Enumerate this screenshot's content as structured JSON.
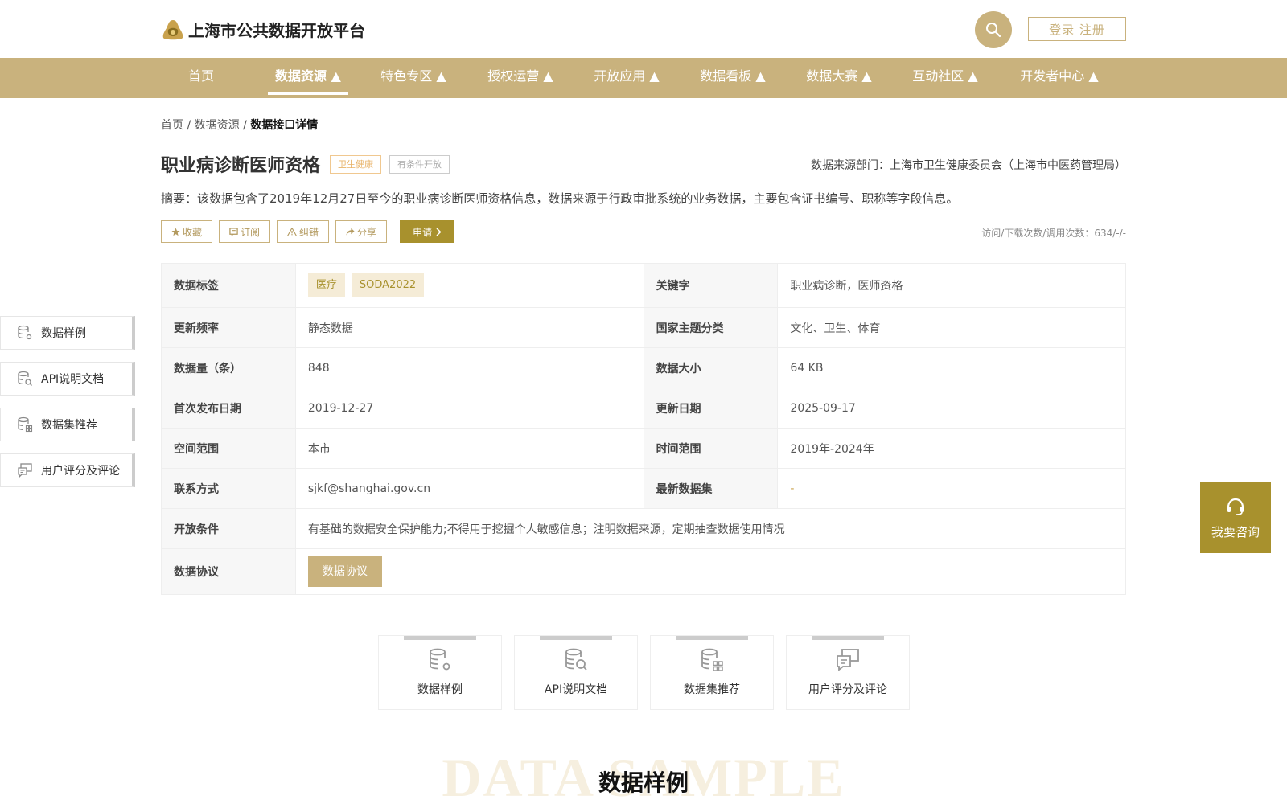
{
  "header": {
    "site_title": "上海市公共数据开放平台",
    "login_label": "登录 注册"
  },
  "nav": {
    "items": [
      {
        "label": "首页"
      },
      {
        "label": "数据资源 ▲"
      },
      {
        "label": "特色专区 ▲"
      },
      {
        "label": "授权运营 ▲"
      },
      {
        "label": "开放应用 ▲"
      },
      {
        "label": "数据看板 ▲"
      },
      {
        "label": "数据大赛 ▲"
      },
      {
        "label": "互动社区 ▲"
      },
      {
        "label": "开发者中心 ▲"
      }
    ],
    "active_index": 1
  },
  "breadcrumb": {
    "home": "首页",
    "sep": " / ",
    "parent": "数据资源",
    "current": "数据接口详情"
  },
  "detail": {
    "title": "职业病诊断医师资格",
    "tag_topic": "卫生健康",
    "tag_open": "有条件开放",
    "source_dept": "数据来源部门：上海市卫生健康委员会（上海市中医药管理局）",
    "summary": "摘要：该数据包含了2019年12月27日至今的职业病诊断医师资格信息，数据来源于行政审批系统的业务数据，主要包含证书编号、职称等字段信息。",
    "visit_count": "访问/下载次数/调用次数：634/-/-"
  },
  "actions": {
    "favorite": "收藏",
    "subscribe": "订阅",
    "correct": "纠错",
    "share": "分享",
    "apply": "申请"
  },
  "info": {
    "tags_label": "数据标签",
    "tags": [
      "医疗",
      "SODA2022"
    ],
    "keywords_label": "关键字",
    "keywords": "职业病诊断，医师资格",
    "freq_label": "更新频率",
    "freq": "静态数据",
    "theme_label": "国家主题分类",
    "theme": "文化、卫生、体育",
    "count_label": "数据量（条）",
    "count": "848",
    "size_label": "数据大小",
    "size": "64 KB",
    "first_pub_label": "首次发布日期",
    "first_pub": "2019-12-27",
    "update_label": "更新日期",
    "update": "2025-09-17",
    "space_label": "空间范围",
    "space": "本市",
    "time_label": "时间范围",
    "time": "2019年-2024年",
    "contact_label": "联系方式",
    "contact": "sjkf@shanghai.gov.cn",
    "latest_label": "最新数据集",
    "latest": "-",
    "condition_label": "开放条件",
    "condition": "有基础的数据安全保护能力;不得用于挖掘个人敏感信息；注明数据来源，定期抽查数据使用情况",
    "protocol_label": "数据协议",
    "protocol_button": "数据协议"
  },
  "sidenav": {
    "items": [
      "数据样例",
      "API说明文档",
      "数据集推荐",
      "用户评分及评论"
    ]
  },
  "consult": {
    "label": "我要咨询"
  },
  "cards": [
    "数据样例",
    "API说明文档",
    "数据集推荐",
    "用户评分及评论"
  ],
  "section": {
    "bg_text": "DATA SAMPLE",
    "title": "数据样例"
  },
  "colors": {
    "brand": "#c9b27d",
    "accent": "#a8912d"
  }
}
